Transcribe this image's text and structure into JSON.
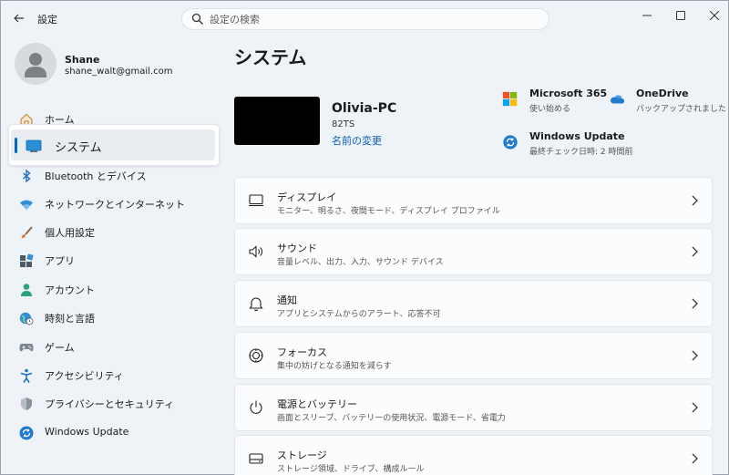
{
  "window": {
    "title": "設定"
  },
  "search": {
    "placeholder": "設定の検索"
  },
  "profile": {
    "name": "Shane",
    "email": "shane_walt@gmail.com"
  },
  "sidebar": {
    "items": [
      {
        "label": "ホーム",
        "icon": "home-icon"
      },
      {
        "label": "システム",
        "icon": "system-icon",
        "active": true
      },
      {
        "label": "Bluetooth とデバイス",
        "icon": "bluetooth-icon"
      },
      {
        "label": "ネットワークとインターネット",
        "icon": "wifi-icon"
      },
      {
        "label": "個人用設定",
        "icon": "brush-icon"
      },
      {
        "label": "アプリ",
        "icon": "apps-icon"
      },
      {
        "label": "アカウント",
        "icon": "account-icon"
      },
      {
        "label": "時刻と言語",
        "icon": "globe-clock-icon"
      },
      {
        "label": "ゲーム",
        "icon": "gamepad-icon"
      },
      {
        "label": "アクセシビリティ",
        "icon": "accessibility-icon"
      },
      {
        "label": "プライバシーとセキュリティ",
        "icon": "shield-icon"
      },
      {
        "label": "Windows Update",
        "icon": "windows-update-icon"
      }
    ]
  },
  "main": {
    "title": "システム",
    "device": {
      "name": "Olivia-PC",
      "model": "82TS",
      "rename": "名前の変更"
    },
    "tiles": [
      {
        "title": "Microsoft 365",
        "sub": "使い始める",
        "icon": "microsoft-365-icon"
      },
      {
        "title": "OneDrive",
        "sub": "バックアップされました",
        "icon": "onedrive-icon"
      },
      {
        "title": "Windows Update",
        "sub": "最終チェック日時: 2 時間前",
        "icon": "windows-update-icon"
      }
    ],
    "cards": [
      {
        "title": "ディスプレイ",
        "sub": "モニター、明るさ、夜間モード、ディスプレイ プロファイル",
        "icon": "display-icon"
      },
      {
        "title": "サウンド",
        "sub": "音量レベル、出力、入力、サウンド デバイス",
        "icon": "speaker-icon"
      },
      {
        "title": "通知",
        "sub": "アプリとシステムからのアラート、応答不可",
        "icon": "bell-icon"
      },
      {
        "title": "フォーカス",
        "sub": "集中の妨げとなる通知を減らす",
        "icon": "focus-icon"
      },
      {
        "title": "電源とバッテリー",
        "sub": "画面とスリープ、バッテリーの使用状況、電源モード、省電力",
        "icon": "power-icon"
      },
      {
        "title": "ストレージ",
        "sub": "ストレージ領域、ドライブ、構成ルール",
        "icon": "storage-icon"
      }
    ]
  },
  "colors": {
    "accent": "#0067c0",
    "link": "#0a5db8",
    "background": "#eef2f7"
  }
}
